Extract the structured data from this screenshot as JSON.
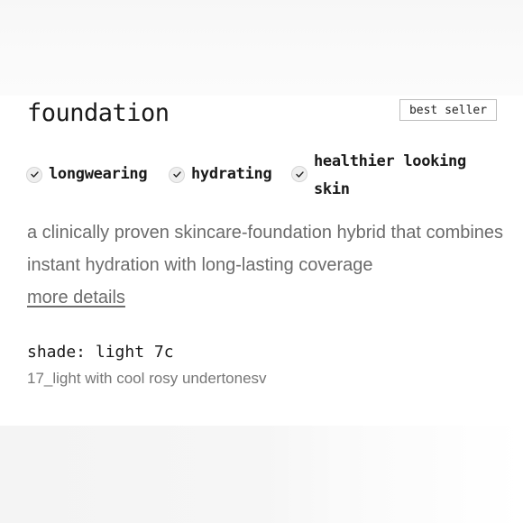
{
  "product": {
    "title": "foundation",
    "badge": "best seller",
    "benefits": [
      {
        "label": "longwearing",
        "icon": "check-icon"
      },
      {
        "label": "hydrating",
        "icon": "check-icon"
      },
      {
        "label": "healthier looking skin",
        "icon": "check-icon"
      }
    ],
    "description": "a clinically proven skincare-foundation hybrid that combines instant hydration with long-lasting coverage",
    "more_details_link": "more details",
    "shade_label": "shade: light 7c",
    "shade_description": "17_light with cool rosy undertonesv"
  },
  "colors": {
    "text_primary": "#1a1a1a",
    "text_secondary": "#6b6b6b",
    "badge_border": "#bdbdbd",
    "check_bg": "#efefef"
  }
}
